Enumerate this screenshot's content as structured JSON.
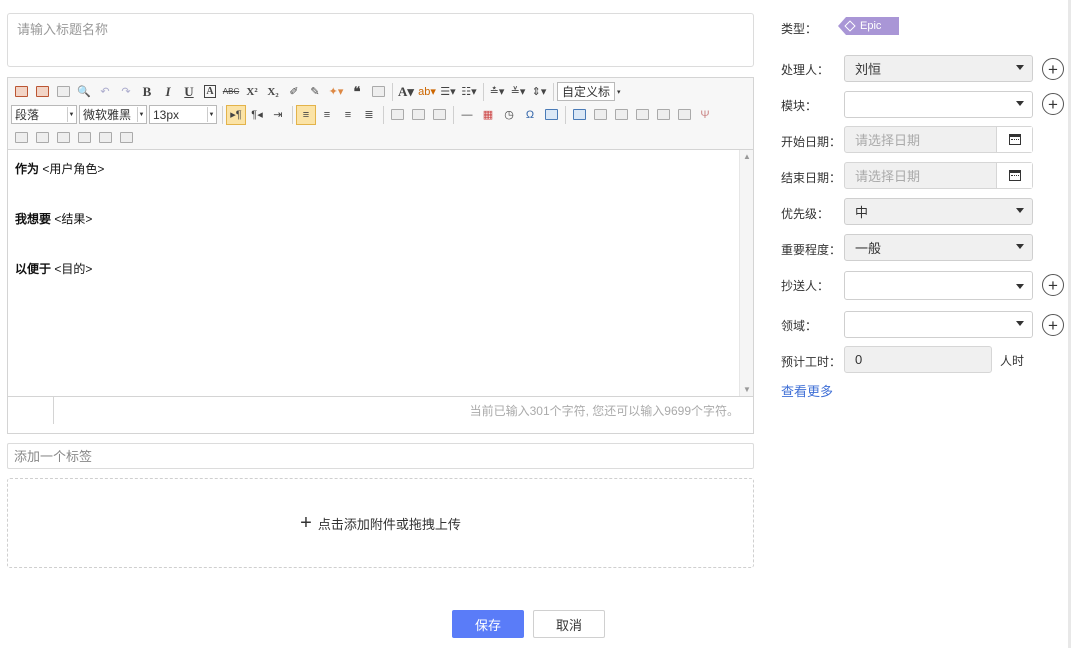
{
  "title_input": {
    "placeholder": "请输入标题名称"
  },
  "editor": {
    "toolbar": {
      "paragraph_select": "段落",
      "font_select": "微软雅黑",
      "size_select": "13px",
      "custom_title": "自定义标"
    },
    "content": [
      {
        "bold": "作为",
        "text": " <用户角色>"
      },
      {
        "bold": "我想要",
        "text": " <结果>"
      },
      {
        "bold": "以便于",
        "text": " <目的>"
      }
    ],
    "status_count": "当前已输入301个字符, 您还可以输入9699个字符。"
  },
  "tag_input": {
    "placeholder": "添加一个标签"
  },
  "upload": {
    "label": "点击添加附件或拖拽上传"
  },
  "buttons": {
    "save": "保存",
    "cancel": "取消"
  },
  "fields": {
    "type": {
      "label": "类型：",
      "value": "Epic",
      "color": "#a996d6"
    },
    "assignee": {
      "label": "处理人：",
      "value": "刘恒"
    },
    "module": {
      "label": "模块：",
      "value": ""
    },
    "start_date": {
      "label": "开始日期：",
      "placeholder": "请选择日期"
    },
    "end_date": {
      "label": "结束日期：",
      "placeholder": "请选择日期"
    },
    "priority": {
      "label": "优先级：",
      "value": "中"
    },
    "importance": {
      "label": "重要程度：",
      "value": "一般"
    },
    "cc": {
      "label": "抄送人：",
      "value": ""
    },
    "domain": {
      "label": "领域：",
      "value": ""
    },
    "estimate": {
      "label": "预计工时：",
      "value": "0",
      "unit": "人时"
    },
    "more": "查看更多"
  },
  "colors": {
    "primary": "#5a7cf8",
    "link": "#3f6fd6"
  }
}
